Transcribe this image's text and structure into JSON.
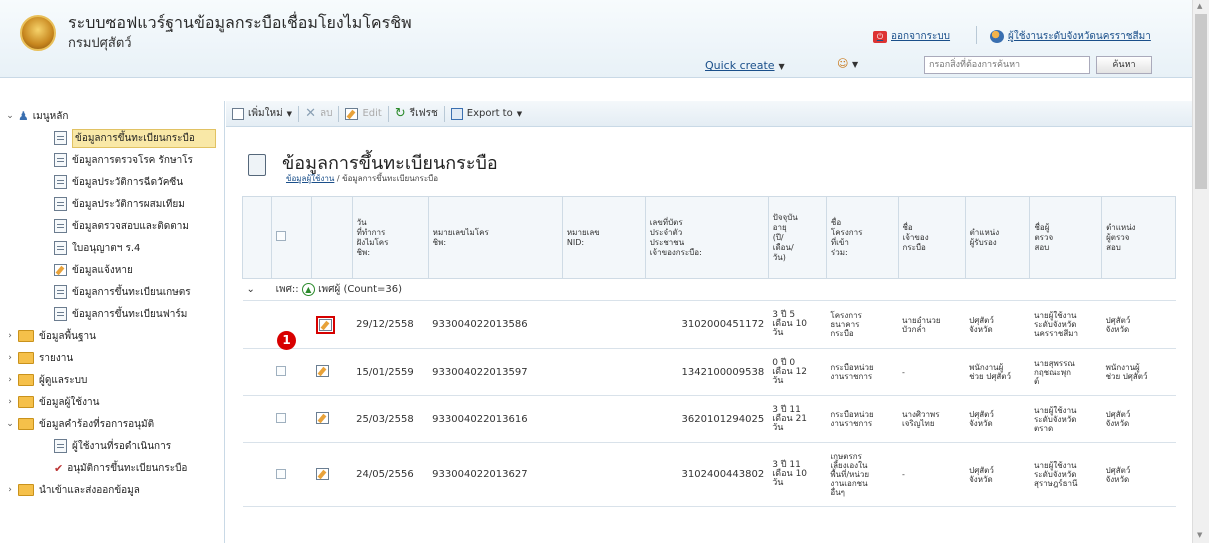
{
  "header": {
    "title": "ระบบซอฟแวร์ฐานข้อมูลกระบือเชื่อมโยงไมโครชิพ",
    "subtitle": "กรมปศุสัตว์",
    "logout_label": "ออกจากระบบ",
    "user_label": "ผู้ใช้งานระดับจังหวัดนครราชสีมา",
    "quick_create": "Quick create",
    "search_placeholder": "กรอกสิ่งที่ต้องการค้นหา",
    "search_button": "ค้นหา"
  },
  "sidebar": {
    "main_menu": "เมนูหลัก",
    "items": [
      "ข้อมูลการขึ้นทะเบียนกระบือ",
      "ข้อมูลการตรวจโรค รักษาโร",
      "ข้อมูลประวัติการฉีดวัคซีน",
      "ข้อมูลประวัติการผสมเทียม",
      "ข้อมูลตรวจสอบและติดตาม",
      "ใบอนุญาตฯ ร.4",
      "ข้อมูลแจ้งหาย",
      "ข้อมูลการขึ้นทะเบียนเกษตร",
      "ข้อมูลการขึ้นทะเบียนฟาร์ม"
    ],
    "folders": [
      "ข้อมูลพื้นฐาน",
      "รายงาน",
      "ผู้ดูแลระบบ",
      "ข้อมูลผู้ใช้งาน"
    ],
    "approval_folder": "ข้อมูลคำร้องที่รอการอนุมัติ",
    "approval_items": [
      "ผู้ใช้งานที่รอดำเนินการ",
      "อนุมัติการขึ้นทะเบียนกระบือ"
    ],
    "import_export": "นำเข้าและส่งออกข้อมูล"
  },
  "toolbar": {
    "new": "เพิ่มใหม่",
    "delete": "ลบ",
    "edit": "Edit",
    "refresh": "รีเฟรช",
    "export": "Export to"
  },
  "page": {
    "title": "ข้อมูลการขึ้นทะเบียนกระบือ",
    "breadcrumb_link": "ข้อมูลผู้ใช้งาน",
    "breadcrumb_current": "/ ข้อมูลการขึ้นทะเบียนกระบือ"
  },
  "table": {
    "headers": [
      "วัน\nที่ทำการ\nฝังไมโคร\nชิพ:",
      "หมายเลขไมโคร\nชิพ:",
      "หมายเลข\nNID:",
      "เลขที่บัตร\nประจำตัว\nประชาชน\nเจ้าของกระบือ:",
      "ปัจจุบัน\nอายุ\n(ปี/\nเดือน/\nวัน)",
      "ชื่อ\nโครงการ\nที่เข้า\nร่วม:",
      "ชื่อ\nเจ้าของ\nกระบือ",
      "ตำแหน่ง\nผู้รับรอง",
      "ชื่อผู้\nตรวจ\nสอบ",
      "ตำแหน่ง\nผู้ตรวจ\nสอบ"
    ],
    "group_label": "เพศ::",
    "group_value": "เพศผู้ (Count=36)",
    "rows": [
      {
        "date": "29/12/2558",
        "chip": "933004022013586",
        "nid": "",
        "id": "3102000451172",
        "age": "3 ปี 5\nเดือน 10\nวัน",
        "project": "โครงการ\nธนาคาร\nกระบือ",
        "owner": "นายอำนวย\nบัวกล่ำ",
        "certpos": "ปศุสัตว์\nจังหวัด",
        "inspector": "นายผู้ใช้งาน\nระดับจังหวัด\nนครราชสีมา",
        "inspos": "ปศุสัตว์\nจังหวัด"
      },
      {
        "date": "15/01/2559",
        "chip": "933004022013597",
        "nid": "",
        "id": "1342100009538",
        "age": "0 ปี 0\nเดือน 12\nวัน",
        "project": "กระบือหน่วย\nงานราชการ",
        "owner": "-",
        "certpos": "พนักงานผู้\nช่วย ปศุสัตว์",
        "inspector": "นายสุพรรณ\nกฤชณะพุก\nต์",
        "inspos": "พนักงานผู้\nช่วย ปศุสัตว์"
      },
      {
        "date": "25/03/2558",
        "chip": "933004022013616",
        "nid": "",
        "id": "3620101294025",
        "age": "3 ปี 11\nเดือน 21\nวัน",
        "project": "กระบือหน่วย\nงานราชการ",
        "owner": "นางศิวาพร\nเจริญไทย",
        "certpos": "ปศุสัตว์\nจังหวัด",
        "inspector": "นายผู้ใช้งาน\nระดับจังหวัด\nตราด",
        "inspos": "ปศุสัตว์\nจังหวัด"
      },
      {
        "date": "24/05/2556",
        "chip": "933004022013627",
        "nid": "",
        "id": "3102400443802",
        "age": "3 ปี 11\nเดือน 10\nวัน",
        "project": "เกษตรกร\nเลี้ยงเองใน\nพื้นที่/หน่วย\nงานเอกชน\nอื่นๆ",
        "owner": "-",
        "certpos": "ปศุสัตว์\nจังหวัด",
        "inspector": "นายผู้ใช้งาน\nระดับจังหวัด\nสุราษฎร์ธานี",
        "inspos": "ปศุสัตว์\nจังหวัด"
      }
    ]
  },
  "annotation": {
    "marker": "1"
  }
}
